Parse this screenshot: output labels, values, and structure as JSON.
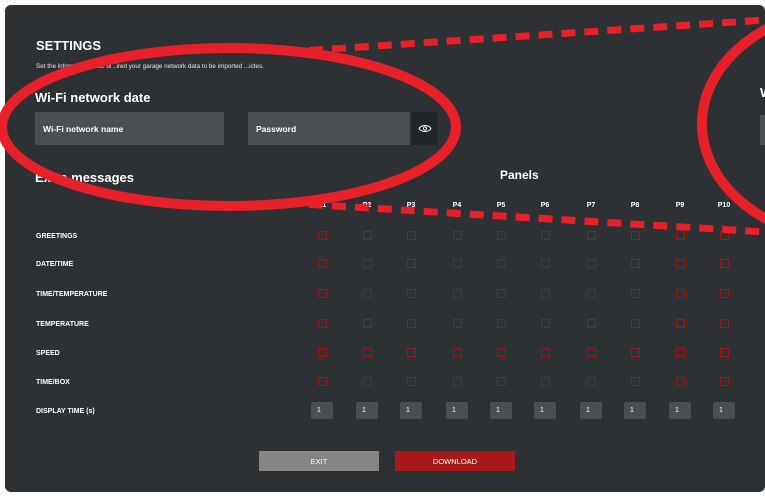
{
  "settings": {
    "title": "SETTINGS",
    "subtitle": "Set the information to be di        ..ired your garage network data to be imported          ...ictes."
  },
  "wifi": {
    "title": "Wi-Fi network date",
    "title_cut": "W",
    "name_field": "Wi-Fi network name",
    "password_field": "Password"
  },
  "extra": {
    "title": "Extra messages"
  },
  "panels": {
    "title": "Panels",
    "columns": [
      "P1",
      "P2",
      "P3",
      "P4",
      "P5",
      "P6",
      "P7",
      "P8",
      "P9",
      "P10"
    ]
  },
  "rows": [
    "GREETINGS",
    "DATE/TIME",
    "TIME/TEMPERATURE",
    "TEMPERATURE",
    "SPEED",
    "TIME/BOX"
  ],
  "display_time": {
    "label": "DISPLAY TIME (s)",
    "values": [
      "1",
      "1",
      "1",
      "1",
      "1",
      "1",
      "1",
      "1",
      "1",
      "1"
    ]
  },
  "buttons": {
    "exit": "EXIT",
    "download": "DOWNLOAD"
  },
  "colors": {
    "background": "#2e3133",
    "field": "#4a4f52",
    "accent_red": "#a81a1a",
    "annotation_red": "#e8202a",
    "exit_gray": "#858585"
  },
  "icons": {
    "password_toggle": "eye-icon"
  }
}
